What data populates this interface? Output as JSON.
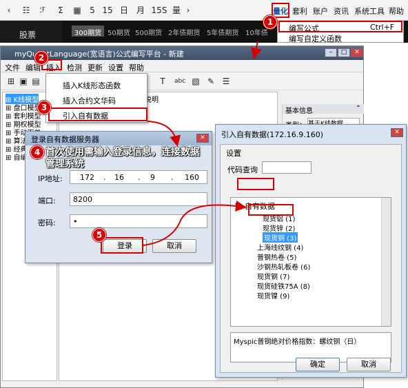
{
  "toolbar": {
    "icons": [
      "back-icon",
      "list-icon",
      "chart-function-icon",
      "sigma-icon",
      "grid-icon"
    ],
    "periods": [
      "5",
      "15",
      "日",
      "月",
      "15S",
      "量"
    ],
    "menus": [
      "量化",
      "套利",
      "账户",
      "资讯",
      "系统工具",
      "帮助"
    ]
  },
  "market": {
    "stock_tab": "股票",
    "periods": [
      "300期货",
      "50期货",
      "500期货",
      "2年债期货",
      "5年债期货",
      "10年债"
    ]
  },
  "quant_dropdown": {
    "items": [
      {
        "label": "编写公式",
        "shortcut": "Ctrl+F"
      },
      {
        "label": "编写自定义函数",
        "shortcut": ""
      }
    ]
  },
  "editor": {
    "title": "myQuantLanguage(宽语言)公式编写平台 - 新建",
    "menu": [
      "文件",
      "编辑",
      "插入",
      "检测",
      "更新",
      "设置",
      "帮助"
    ],
    "tree": [
      "K线模型",
      "盘口模型",
      "套利模型",
      "期权模型",
      "手动下单",
      "算法绑定多模组案例",
      "经典",
      "自编"
    ],
    "tab_label": "说明",
    "info_title": "基本信息",
    "info_type_label": "类型：",
    "info_type_value": "基于K线数据"
  },
  "insert_menu": {
    "items": [
      "插入K线形态函数",
      "插入合约文华码",
      "引入自有数据"
    ]
  },
  "annotations": {
    "step4": "首次使用需输入登录信息，连接数据管理系统"
  },
  "login": {
    "title": "登录自有数据服务器",
    "ip_label": "IP地址:",
    "ip": [
      "172",
      "16",
      "9",
      "160"
    ],
    "port_label": "端口:",
    "port": "8200",
    "password_label": "密码:",
    "password": "•",
    "login_btn": "登录",
    "cancel_btn": "取消"
  },
  "import_dlg": {
    "title": "引入自有数据(172.16.9.160)",
    "section": "设置",
    "code_query_label": "代码查询",
    "root": "自有数据",
    "items": [
      "现货铝 (1)",
      "现货锌 (2)",
      "现货铜 (3)",
      "上海线纹钢 (4)",
      "普钢热卷 (5)",
      "沙钢热轧板卷 (6)",
      "现货钢 (7)",
      "现货硅铁75A (8)",
      "现货镍 (9)"
    ],
    "selected_index": 2,
    "description": "Myspic普钢绝对价格指数：螺纹钢（日）",
    "ok_btn": "确定",
    "cancel_btn": "取消"
  },
  "badges": [
    "1",
    "2",
    "3",
    "4",
    "5"
  ],
  "colors": {
    "highlight": "#d60000",
    "selection": "#3399ff",
    "title_dark": "#3e4f66"
  }
}
